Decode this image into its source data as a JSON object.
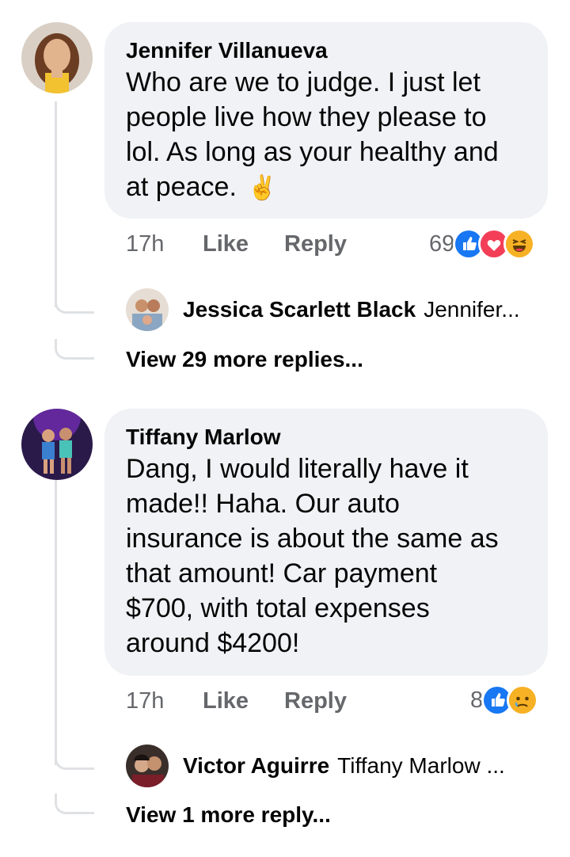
{
  "comments": [
    {
      "author": "Jennifer Villanueva",
      "text_lines": [
        "Who are we to judge. I just let",
        "people live how they please to",
        "lol. As long as your healthy and",
        "at peace."
      ],
      "emoji": "✌️",
      "time": "17h",
      "like_label": "Like",
      "reply_label": "Reply",
      "reaction_count": "69",
      "reactions": [
        "like-icon",
        "love-icon",
        "haha-icon"
      ],
      "reply_preview": {
        "name": "Jessica Scarlett Black",
        "snippet": "Jennifer..."
      },
      "view_more": "View 29 more replies..."
    },
    {
      "author": "Tiffany Marlow",
      "text_lines": [
        "Dang, I would literally have it",
        "made!! Haha. Our auto",
        "insurance is about the same as",
        "that amount! Car payment",
        "$700, with total expenses",
        "around $4200!"
      ],
      "time": "17h",
      "like_label": "Like",
      "reply_label": "Reply",
      "reaction_count": "8",
      "reactions": [
        "like-icon",
        "sad-icon"
      ],
      "reply_preview": {
        "name": "Victor Aguirre",
        "snippet": "Tiffany Marlow ..."
      },
      "view_more": "View 1 more reply..."
    }
  ],
  "colors": {
    "bubble": "#f0f2f5",
    "secondary_text": "#65676b",
    "like_blue": "#1877f2",
    "love_red": "#f33e58",
    "emoji_yellow": "#f7b125"
  }
}
